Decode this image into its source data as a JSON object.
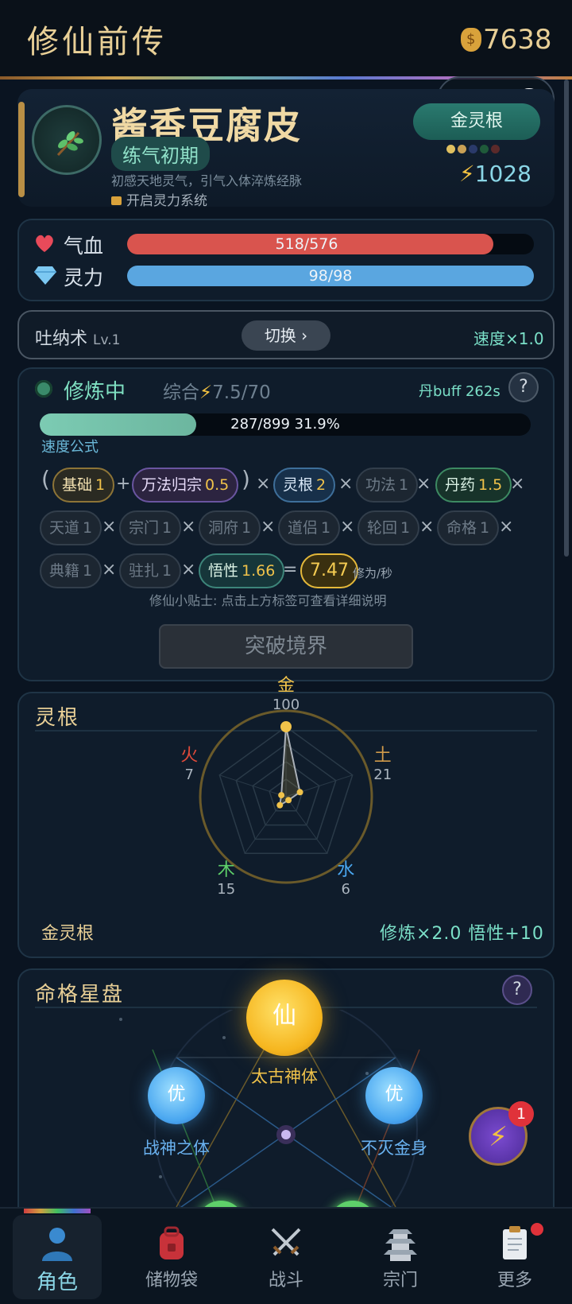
{
  "header": {
    "title": "修仙前传",
    "coins": "7638"
  },
  "profile": {
    "name": "酱香豆腐皮",
    "realm": "练气初期",
    "realm_desc": "初感天地灵气，引气入体淬炼经脉",
    "unlock_text": "开启灵力系统",
    "root_badge": "金灵根",
    "power": "1028",
    "pip_colors": [
      "#e0c060",
      "#c9a055",
      "#2a3a6a",
      "#1f5a3a",
      "#5a2a2a"
    ]
  },
  "vitals": {
    "hp_label": "气血",
    "hp_text": "518/576",
    "hp_fraction": 0.9,
    "mp_label": "灵力",
    "mp_text": "98/98",
    "mp_fraction": 1.0
  },
  "technique": {
    "name": "吐纳术",
    "level": "Lv.1",
    "switch_label": "切换 ›",
    "speed": "速度×1.0"
  },
  "cultivation": {
    "status": "修炼中",
    "overall_prefix": "综合",
    "overall_value": "7.5/70",
    "dan_buff": "丹buff 262s",
    "help": "?",
    "exp_text": "287/899  31.9%",
    "exp_fraction": 0.319,
    "formula_label": "速度公式",
    "chips": {
      "base": {
        "label": "基础",
        "value": "1"
      },
      "wanfa": {
        "label": "万法归宗",
        "value": "0.5"
      },
      "linggen": {
        "label": "灵根",
        "value": "2"
      },
      "gongfa": {
        "label": "功法",
        "value": "1"
      },
      "danyao": {
        "label": "丹药",
        "value": "1.5"
      },
      "tiandao": {
        "label": "天道",
        "value": "1"
      },
      "zongmen": {
        "label": "宗门",
        "value": "1"
      },
      "dongfu": {
        "label": "洞府",
        "value": "1"
      },
      "daolv": {
        "label": "道侣",
        "value": "1"
      },
      "lunhui": {
        "label": "轮回",
        "value": "1"
      },
      "mingge": {
        "label": "命格",
        "value": "1"
      },
      "dianji": {
        "label": "典籍",
        "value": "1"
      },
      "zhuzha": {
        "label": "驻扎",
        "value": "1"
      },
      "wuxing": {
        "label": "悟性",
        "value": "1.66"
      },
      "result": "7.47"
    },
    "unit": "修为/秒",
    "tip": "修仙小贴士: 点击上方标签可查看详细说明",
    "breakthrough": "突破境界"
  },
  "spirit_root": {
    "title": "灵根",
    "elements": [
      {
        "name": "金",
        "value": 100,
        "color": "#f0c24a"
      },
      {
        "name": "土",
        "value": 21,
        "color": "#d09a4a"
      },
      {
        "name": "水",
        "value": 6,
        "color": "#4aa7f0"
      },
      {
        "name": "木",
        "value": 15,
        "color": "#5ed06a"
      },
      {
        "name": "火",
        "value": 7,
        "color": "#e04a3a"
      }
    ],
    "root_name": "金灵根",
    "bonus": "修炼×2.0  悟性+10"
  },
  "star_chart": {
    "title": "命格星盘",
    "help": "?",
    "main": {
      "glyph": "仙",
      "label": "太古神体"
    },
    "left": {
      "glyph": "优",
      "label": "战神之体"
    },
    "right": {
      "glyph": "优",
      "label": "不灭金身"
    },
    "fab_badge": "1"
  },
  "tabs": [
    {
      "label": "角色",
      "icon": "person-icon"
    },
    {
      "label": "储物袋",
      "icon": "backpack-icon"
    },
    {
      "label": "战斗",
      "icon": "swords-icon"
    },
    {
      "label": "宗门",
      "icon": "pagoda-icon"
    },
    {
      "label": "更多",
      "icon": "clipboard-icon"
    }
  ]
}
